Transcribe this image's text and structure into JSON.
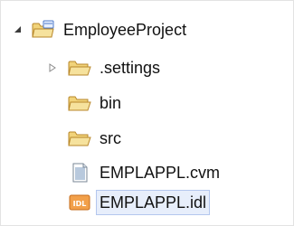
{
  "project_explorer": {
    "project": {
      "label": "EmployeeProject",
      "expanded": true,
      "icon": "project-folder-icon"
    },
    "items": [
      {
        "label": ".settings",
        "icon": "folder-icon",
        "twisty": "collapsed"
      },
      {
        "label": "bin",
        "icon": "folder-icon"
      },
      {
        "label": "src",
        "icon": "folder-icon"
      },
      {
        "label": "EMPLAPPL.cvm",
        "icon": "file-icon"
      },
      {
        "label": "EMPLAPPL.idl",
        "icon": "idl-file-icon",
        "selected": true,
        "badge": "IDL"
      }
    ]
  }
}
